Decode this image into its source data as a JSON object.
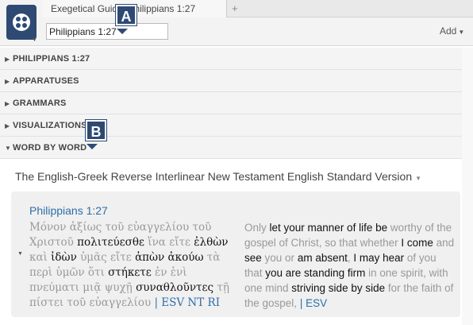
{
  "toolbar": {
    "tab_title": "Exegetical Guide: Philippians 1:27",
    "reference_value": "Philippians 1:27",
    "add_label": "Add",
    "new_tab_glyph": "+"
  },
  "sections": [
    {
      "label": "PHILIPPIANS 1:27"
    },
    {
      "label": "APPARATUSES"
    },
    {
      "label": "GRAMMARS"
    },
    {
      "label": "VISUALIZATIONS"
    },
    {
      "label": "WORD BY WORD"
    }
  ],
  "word_by_word": {
    "version_title": "The English-Greek Reverse Interlinear New Testament English Standard Version",
    "passage_ref": "Philippians 1:27",
    "greek": [
      {
        "t": "Μόνον ἀξίως τοῦ εὐαγγελίου τοῦ Χριστοῦ ",
        "h": false
      },
      {
        "t": "πολιτεύεσθε",
        "h": true
      },
      {
        "t": " ἵνα εἴτε ",
        "h": false
      },
      {
        "t": "ἐλθὼν",
        "h": true
      },
      {
        "t": " καὶ ",
        "h": false
      },
      {
        "t": "ἰδὼν",
        "h": true
      },
      {
        "t": " ὑμᾶς εἴτε ",
        "h": false
      },
      {
        "t": "ἀπὼν ἀκούω",
        "h": true
      },
      {
        "t": " τὰ περὶ ὑμῶν ὅτι ",
        "h": false
      },
      {
        "t": "στήκετε",
        "h": true
      },
      {
        "t": " ἐν ἑνὶ πνεύματι μιᾷ ψυχῇ ",
        "h": false
      },
      {
        "t": "συναθλοῦντες",
        "h": true
      },
      {
        "t": " τῇ πίστει τοῦ εὐαγγελίου ",
        "h": false
      },
      {
        "t": " | ESV NT RI",
        "l": true
      }
    ],
    "english": [
      {
        "t": "Only ",
        "h": false
      },
      {
        "t": "let your manner of life",
        "h": true
      },
      {
        "t": " be ",
        "h": true
      },
      {
        "t": "worthy of the gospel of Christ, so that whether ",
        "h": false
      },
      {
        "t": "I come",
        "h": true
      },
      {
        "t": " and ",
        "h": false
      },
      {
        "t": "see",
        "h": true
      },
      {
        "t": " you or ",
        "h": false
      },
      {
        "t": "am absent",
        "h": true
      },
      {
        "t": ", ",
        "h": false
      },
      {
        "t": "I may hear",
        "h": true
      },
      {
        "t": " of you that ",
        "h": false
      },
      {
        "t": "you are standing firm",
        "h": true
      },
      {
        "t": " in one spirit, with one mind ",
        "h": false
      },
      {
        "t": "striving side by side",
        "h": true
      },
      {
        "t": " for the faith of the gospel, ",
        "h": false
      },
      {
        "t": " | ESV",
        "l": true
      }
    ]
  },
  "callouts": {
    "a": "A",
    "b": "B"
  },
  "colors": {
    "accent": "#2e4a73",
    "link": "#2d6ea8"
  }
}
